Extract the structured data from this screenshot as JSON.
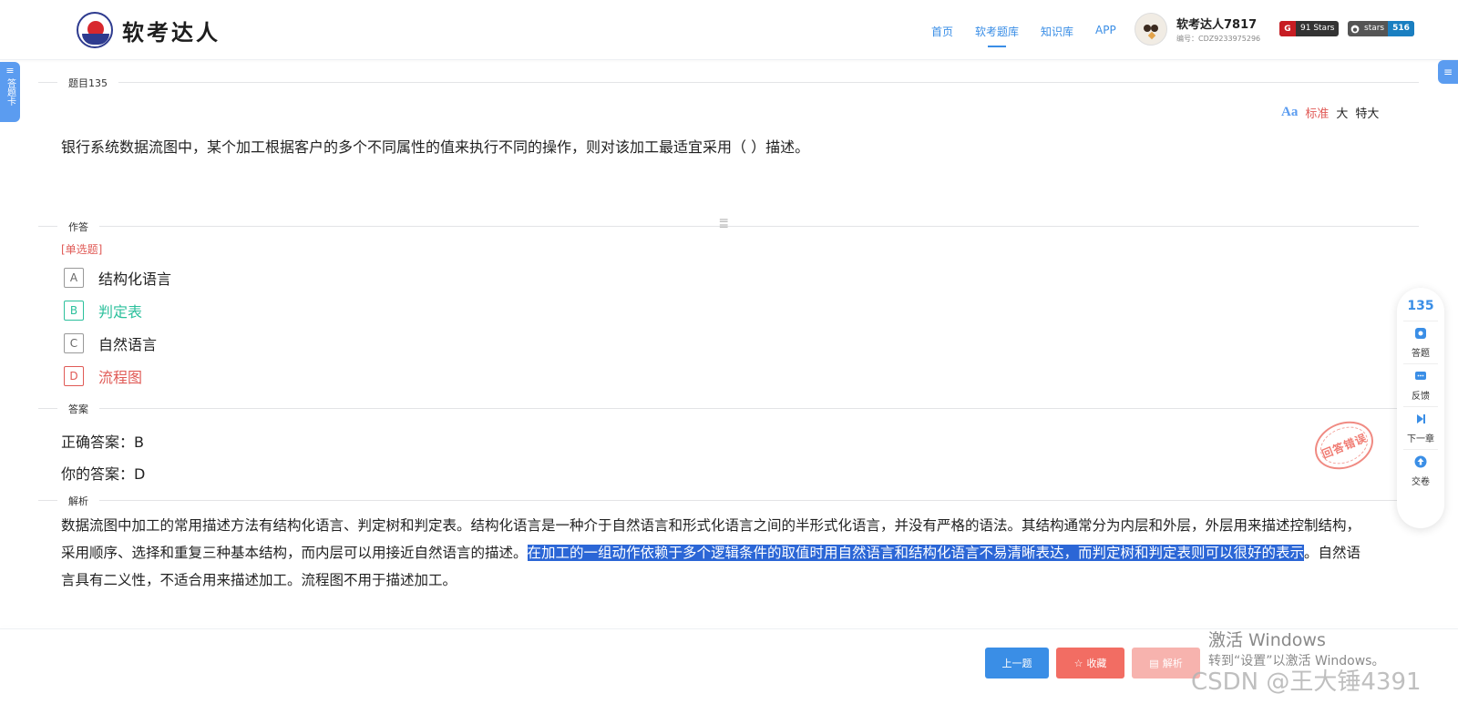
{
  "header": {
    "logo_text": "软考达人",
    "nav": [
      "首页",
      "软考题库",
      "知识库",
      "APP"
    ],
    "nav_active": "软考题库",
    "user": {
      "name": "软考达人7817",
      "id": "编号：CDZ9233975296"
    },
    "badges": {
      "gitee": {
        "icon": "G",
        "text": "91 Stars"
      },
      "github": {
        "label": "stars",
        "count": "516"
      }
    }
  },
  "side": {
    "left_tab_label": "答题卡"
  },
  "question": {
    "section_label": "题目135",
    "text": "银行系统数据流图中，某个加工根据客户的多个不同属性的值来执行不同的操作，则对该加工最适宜采用（ ）描述。",
    "font_size_options": [
      "标准",
      "大",
      "特大"
    ],
    "font_size_active": "标准"
  },
  "answer_area": {
    "section_label": "作答",
    "type": "[单选题]",
    "options": [
      {
        "letter": "A",
        "text": "结构化语言",
        "state": "normal"
      },
      {
        "letter": "B",
        "text": "判定表",
        "state": "correct"
      },
      {
        "letter": "C",
        "text": "自然语言",
        "state": "normal"
      },
      {
        "letter": "D",
        "text": "流程图",
        "state": "wrong"
      }
    ]
  },
  "result": {
    "section_label": "答案",
    "correct": "正确答案：B",
    "yours": "你的答案：D",
    "stamp": "回答错误"
  },
  "analysis": {
    "section_label": "解析",
    "text_before": "数据流图中加工的常用描述方法有结构化语言、判定树和判定表。结构化语言是一种介于自然语言和形式化语言之间的半形式化语言，并没有严格的语法。其结构通常分为内层和外层，外层用来描述控制结构，采用顺序、选择和重复三种基本结构，而内层可以用接近自然语言的描述。",
    "text_highlight": "在加工的一组动作依赖于多个逻辑条件的取值时用自然语言和结构化语言不易清晰表达，而判定树和判定表则可以很好的表示",
    "text_after": "。自然语言具有二义性，不适合用来描述加工。流程图不用于描述加工。"
  },
  "float_panel": {
    "number": "135",
    "items": [
      {
        "label": "答题",
        "icon": "shield-icon"
      },
      {
        "label": "反馈",
        "icon": "chat-icon"
      },
      {
        "label": "下一章",
        "icon": "skip-next-icon"
      },
      {
        "label": "交卷",
        "icon": "upload-icon"
      }
    ]
  },
  "footer": {
    "prev": "上一题",
    "fav": "收藏",
    "analysis": "解析"
  },
  "watermarks": {
    "activate_title": "激活 Windows",
    "activate_sub": "转到“设置”以激活 Windows。",
    "csdn": "CSDN @王大锤4391"
  },
  "colors": {
    "primary": "#3a8ee6",
    "correct": "#2cc09c",
    "wrong": "#e05a56",
    "highlight": "#2b66d6"
  }
}
